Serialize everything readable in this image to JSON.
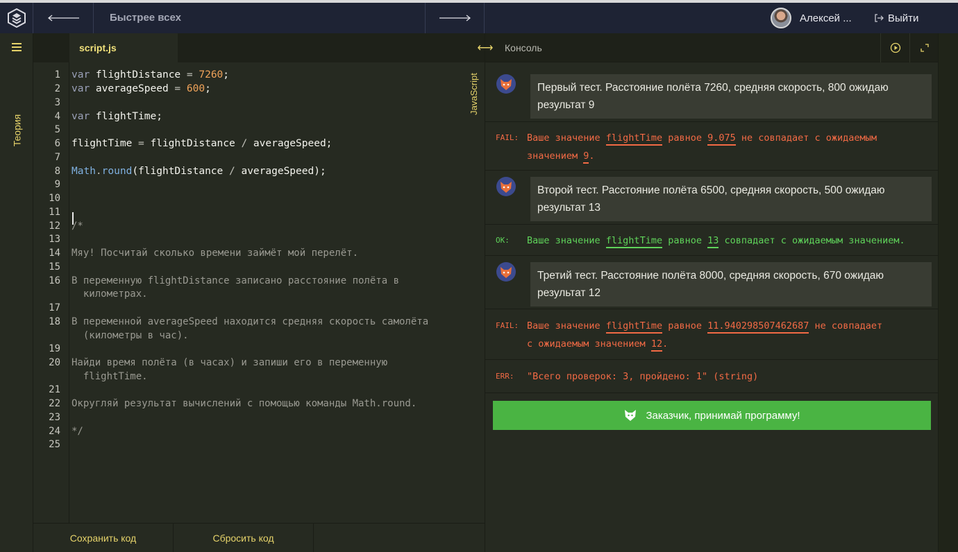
{
  "topbar": {
    "title": "Быстрее всех",
    "user_name": "Алексей ...",
    "logout_label": "Выйти"
  },
  "sidebar": {
    "theory_label": "Теория"
  },
  "editor": {
    "tab_label": "script.js",
    "language_label": "JavaScript",
    "line_numbers": [
      "1",
      "2",
      "3",
      "4",
      "5",
      "6",
      "7",
      "8",
      "9",
      "10",
      "11",
      "12",
      "13",
      "14",
      "15",
      "16",
      "17",
      "18",
      "19",
      "20",
      "21",
      "22",
      "23",
      "24",
      "25"
    ],
    "code": {
      "l1_kw": "var",
      "l1_name": " flightDistance ",
      "l1_op": "=",
      "l1_num": "7260",
      "l1_end": ";",
      "l2_kw": "var",
      "l2_name": " averageSpeed ",
      "l2_op": "=",
      "l2_num": "600",
      "l2_end": ";",
      "l4_kw": "var",
      "l4_name": " flightTime;",
      "l6_a": "flightTime ",
      "l6_op": "=",
      "l6_b": " flightDistance ",
      "l6_op2": "/",
      "l6_c": " averageSpeed;",
      "l8_obj": "Math",
      "l8_dot": ".",
      "l8_fn": "round",
      "l8_a": "(flightDistance ",
      "l8_op": "/",
      "l8_b": " averageSpeed);",
      "l12": "/*",
      "l14": "Мяу! Посчитай сколько времени займёт мой перелёт.",
      "l16a": "В переменную flightDistance записано расстояние полёта в",
      "l16b": "  километрах.",
      "l18a": "В переменной averageSpeed находится средняя скорость самолёта",
      "l18b": "  (километры в час).",
      "l20a": "Найди время полёта (в часах) и запиши его в переменную",
      "l20b": "  flightTime.",
      "l22": "Округляй результат вычислений с помощью команды Math.round.",
      "l24": "*/"
    },
    "save_label": "Сохранить код",
    "reset_label": "Сбросить код"
  },
  "console": {
    "title": "Консоль",
    "tests": [
      {
        "text": "Первый тест. Расстояние полёта 7260, средняя скорость, 800 ожидаю результат 9"
      },
      {
        "text": "Второй тест. Расстояние полёта 6500, средняя скорость, 500 ожидаю результат 13"
      },
      {
        "text": "Третий тест. Расстояние полёта 8000, средняя скорость, 670 ожидаю результат 12"
      }
    ],
    "results": [
      {
        "tag": "FAIL:",
        "p1": "Ваше значение ",
        "var": "flightTime",
        "p2": " равное ",
        "got": "9.075",
        "p3": " не совпадает с ожидаемым",
        "p4": "значением ",
        "expected": "9",
        "p5": "."
      },
      {
        "tag": "OK:",
        "p1": "Ваше значение ",
        "var": "flightTime",
        "p2": " равное ",
        "got": "13",
        "p3": " совпадает с ожидаемым значением."
      },
      {
        "tag": "FAIL:",
        "p1": "Ваше значение ",
        "var": "flightTime",
        "p2": " равное ",
        "got": "11.940298507462687",
        "p3": " не совпадает",
        "p4": "с ожидаемым значением ",
        "expected": "12",
        "p5": "."
      },
      {
        "tag": "ERR:",
        "text": "\"Всего проверок: 3, пройдено: 1\" (string)"
      }
    ],
    "accept_label": "Заказчик, принимай программу!"
  },
  "colors": {
    "accent_yellow": "#e6d36a",
    "fail": "#f26a45",
    "ok": "#5fd35a",
    "accept_bg": "#4ab443",
    "topbar_bg": "#1e2334"
  }
}
